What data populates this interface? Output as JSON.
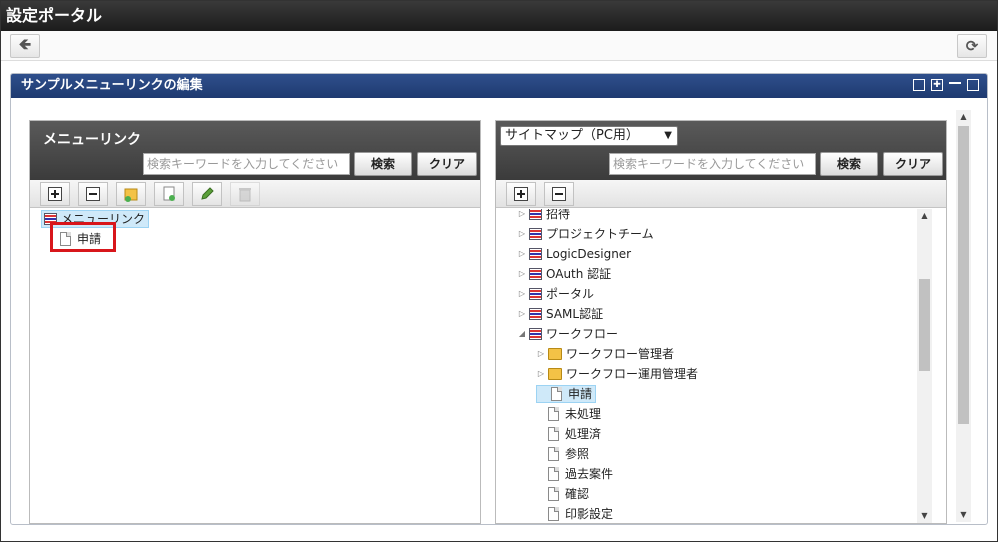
{
  "app": {
    "title": "設定ポータル"
  },
  "portlet": {
    "title": "サンプルメニューリンクの編集"
  },
  "left_panel": {
    "title": "メニューリンク",
    "search_placeholder": "検索キーワードを入力してください",
    "search_button": "検索",
    "clear_button": "クリア",
    "toolbar": [
      "plus-icon",
      "minus-icon",
      "folder-add-icon",
      "page-add-icon",
      "pencil-icon",
      "trash-icon"
    ],
    "tree": [
      {
        "label": "メニューリンク",
        "icon": "menu-list-icon",
        "selected": true
      },
      {
        "label": "申請",
        "icon": "link-page-icon",
        "selected": false
      }
    ]
  },
  "right_panel": {
    "select_value": "サイトマップ（PC用）",
    "search_placeholder": "検索キーワードを入力してください",
    "search_button": "検索",
    "clear_button": "クリア",
    "toolbar": [
      "plus-icon",
      "minus-icon"
    ],
    "tree": [
      {
        "label": "招待",
        "icon": "list-icon",
        "level": 0,
        "expander": "collapsed"
      },
      {
        "label": "プロジェクトチーム",
        "icon": "list-icon",
        "level": 0,
        "expander": "collapsed"
      },
      {
        "label": "LogicDesigner",
        "icon": "list-icon",
        "level": 0,
        "expander": "collapsed"
      },
      {
        "label": "OAuth 認証",
        "icon": "list-icon",
        "level": 0,
        "expander": "collapsed"
      },
      {
        "label": "ポータル",
        "icon": "list-icon",
        "level": 0,
        "expander": "collapsed"
      },
      {
        "label": "SAML認証",
        "icon": "list-icon",
        "level": 0,
        "expander": "collapsed"
      },
      {
        "label": "ワークフロー",
        "icon": "list-icon",
        "level": 0,
        "expander": "expanded"
      },
      {
        "label": "ワークフロー管理者",
        "icon": "folder-icon",
        "level": 1,
        "expander": "collapsed"
      },
      {
        "label": "ワークフロー運用管理者",
        "icon": "folder-icon",
        "level": 1,
        "expander": "collapsed"
      },
      {
        "label": "申請",
        "icon": "page-icon",
        "level": 1,
        "expander": "none",
        "selected": true
      },
      {
        "label": "未処理",
        "icon": "page-icon",
        "level": 1,
        "expander": "none"
      },
      {
        "label": "処理済",
        "icon": "page-icon",
        "level": 1,
        "expander": "none"
      },
      {
        "label": "参照",
        "icon": "page-icon",
        "level": 1,
        "expander": "none"
      },
      {
        "label": "過去案件",
        "icon": "page-icon",
        "level": 1,
        "expander": "none"
      },
      {
        "label": "確認",
        "icon": "page-icon",
        "level": 1,
        "expander": "none"
      },
      {
        "label": "印影設定",
        "icon": "page-icon",
        "level": 1,
        "expander": "none"
      }
    ]
  }
}
